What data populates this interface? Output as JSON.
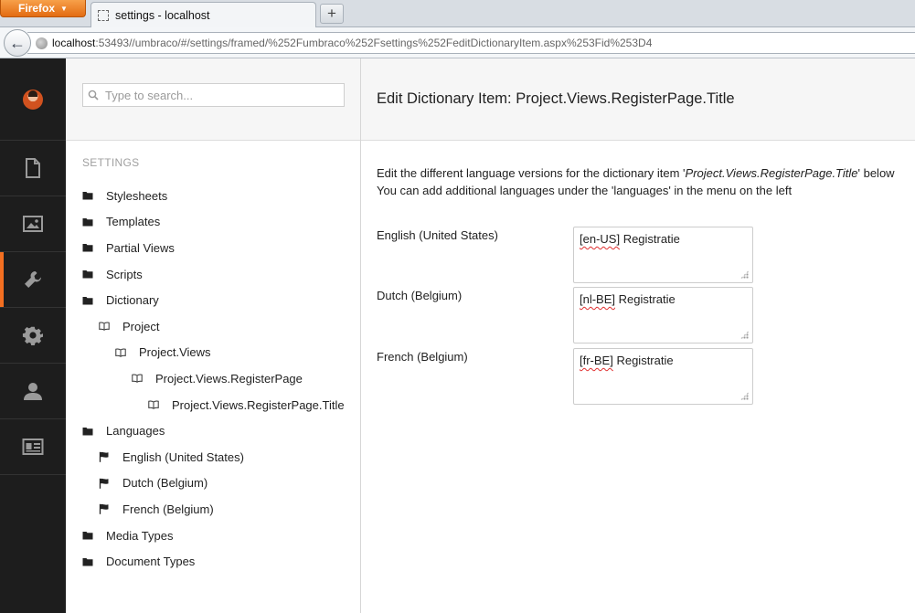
{
  "browser": {
    "menu_button": "Firefox",
    "tab_title": "settings - localhost",
    "newtab_label": "+",
    "url_host": "localhost",
    "url_rest": ":53493//umbraco/#/settings/framed/%252Fumbraco%252Fsettings%252FeditDictionaryItem.aspx%253Fid%253D4"
  },
  "sections": [
    {
      "name": "content",
      "icon": "document-icon",
      "active": false
    },
    {
      "name": "media",
      "icon": "image-icon",
      "active": false
    },
    {
      "name": "settings",
      "icon": "wrench-icon",
      "active": true
    },
    {
      "name": "developer",
      "icon": "gear-icon",
      "active": false
    },
    {
      "name": "users",
      "icon": "user-icon",
      "active": false
    },
    {
      "name": "members",
      "icon": "id-card-icon",
      "active": false
    }
  ],
  "tree": {
    "search_placeholder": "Type to search...",
    "title": "SETTINGS",
    "nodes": [
      {
        "label": "Stylesheets",
        "icon": "folder-icon",
        "level": 0
      },
      {
        "label": "Templates",
        "icon": "folder-icon",
        "level": 0
      },
      {
        "label": "Partial Views",
        "icon": "folder-icon",
        "level": 0
      },
      {
        "label": "Scripts",
        "icon": "folder-icon",
        "level": 0
      },
      {
        "label": "Dictionary",
        "icon": "folder-icon",
        "level": 0
      },
      {
        "label": "Project",
        "icon": "book-icon",
        "level": 1
      },
      {
        "label": "Project.Views",
        "icon": "book-icon",
        "level": 2
      },
      {
        "label": "Project.Views.RegisterPage",
        "icon": "book-icon",
        "level": 3
      },
      {
        "label": "Project.Views.RegisterPage.Title",
        "icon": "book-icon",
        "level": 4
      },
      {
        "label": "Languages",
        "icon": "folder-icon",
        "level": 0
      },
      {
        "label": "English (United States)",
        "icon": "flag-icon",
        "level": 1
      },
      {
        "label": "Dutch (Belgium)",
        "icon": "flag-icon",
        "level": 1
      },
      {
        "label": "French (Belgium)",
        "icon": "flag-icon",
        "level": 1
      },
      {
        "label": "Media Types",
        "icon": "folder-icon",
        "level": 0
      },
      {
        "label": "Document Types",
        "icon": "folder-icon",
        "level": 0
      }
    ]
  },
  "editor": {
    "title": "Edit Dictionary Item: Project.Views.RegisterPage.Title",
    "intro_before": "Edit the different language versions for the dictionary item '",
    "intro_item": "Project.Views.RegisterPage.Title",
    "intro_after": "' below",
    "intro_line2": "You can add additional languages under the 'languages' in the menu on the left",
    "languages": [
      {
        "label": "English (United States)",
        "code": "[en-US]",
        "value": " Registratie"
      },
      {
        "label": "Dutch (Belgium)",
        "code": "[nl-BE]",
        "value": " Registratie"
      },
      {
        "label": "French (Belgium)",
        "code": "[fr-BE]",
        "value": " Registratie"
      }
    ]
  },
  "colors": {
    "accent": "#f36f21",
    "section_bar": "#1d1d1d",
    "section_icon": "#9a9a9a",
    "header_bg": "#f6f6f6"
  }
}
